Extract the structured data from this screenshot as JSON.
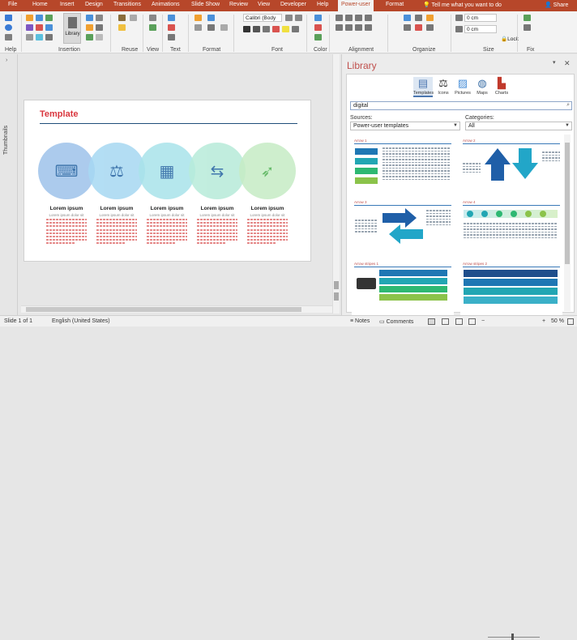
{
  "tabs": [
    "File",
    "Home",
    "Insert",
    "Design",
    "Transitions",
    "Animations",
    "Slide Show",
    "Review",
    "View",
    "Developer",
    "Help",
    "Power-user",
    "Format"
  ],
  "tell_me": "Tell me what you want to do",
  "share": "Share",
  "ribbon": {
    "groups": [
      "Help",
      "Insertion",
      "Reuse",
      "View",
      "Text",
      "Format",
      "Font",
      "Color",
      "Alignment",
      "Organize",
      "Size",
      "Fix"
    ],
    "library_button": "Library",
    "font_name": "Calibri (Body",
    "size_w": "0 cm",
    "size_h": "0 cm",
    "lock": "Lock"
  },
  "thumbnails_label": "Thumbnails",
  "slide": {
    "title": "Template",
    "columns": [
      {
        "title": "Lorem ipsum",
        "sub": "Lorem ipsum dolor sit",
        "icon": "desk-person-icon",
        "glyph": "⌨",
        "color": "#9ec3ea"
      },
      {
        "title": "Lorem ipsum",
        "sub": "Lorem ipsum dolor sit",
        "icon": "gavel-icon",
        "glyph": "⚖",
        "color": "#a6d8f2"
      },
      {
        "title": "Lorem ipsum",
        "sub": "Lorem ipsum dolor sit",
        "icon": "chart-board-icon",
        "glyph": "▦",
        "color": "#a9e3ea"
      },
      {
        "title": "Lorem ipsum",
        "sub": "Lorem ipsum dolor sit",
        "icon": "signpost-icon",
        "glyph": "⇆",
        "color": "#b7ebd9"
      },
      {
        "title": "Lorem ipsum",
        "sub": "Lorem ipsum dolor sit",
        "icon": "rocket-icon",
        "glyph": "➶",
        "color": "#c6ecc5"
      }
    ]
  },
  "library": {
    "title": "Library",
    "categories": [
      {
        "label": "Templates",
        "icon": "templates-icon",
        "glyph": "▤"
      },
      {
        "label": "Icons",
        "icon": "scales-icon",
        "glyph": "⚖"
      },
      {
        "label": "Pictures",
        "icon": "picture-icon",
        "glyph": "▨"
      },
      {
        "label": "Maps",
        "icon": "globe-icon",
        "glyph": "◍"
      },
      {
        "label": "Charts",
        "icon": "chart-icon",
        "glyph": "▙"
      }
    ],
    "search_value": "digital",
    "sources_label": "Sources:",
    "sources_value": "Power-user templates",
    "categories_label": "Categories:",
    "categories_value": "All",
    "cards": [
      {
        "title": "Arrow 1"
      },
      {
        "title": "Arrow 2"
      },
      {
        "title": "Arrow 3"
      },
      {
        "title": "Arrow 4"
      },
      {
        "title": "Arrow stripes 1"
      },
      {
        "title": "Arrow stripes 2"
      }
    ]
  },
  "status": {
    "slide": "Slide 1 of 1",
    "language": "English (United States)",
    "notes": "Notes",
    "comments": "Comments",
    "zoom": "50 %"
  },
  "colors": {
    "accent": "#b7472a",
    "title_red": "#d9363e",
    "library_title": "#c0504d"
  }
}
